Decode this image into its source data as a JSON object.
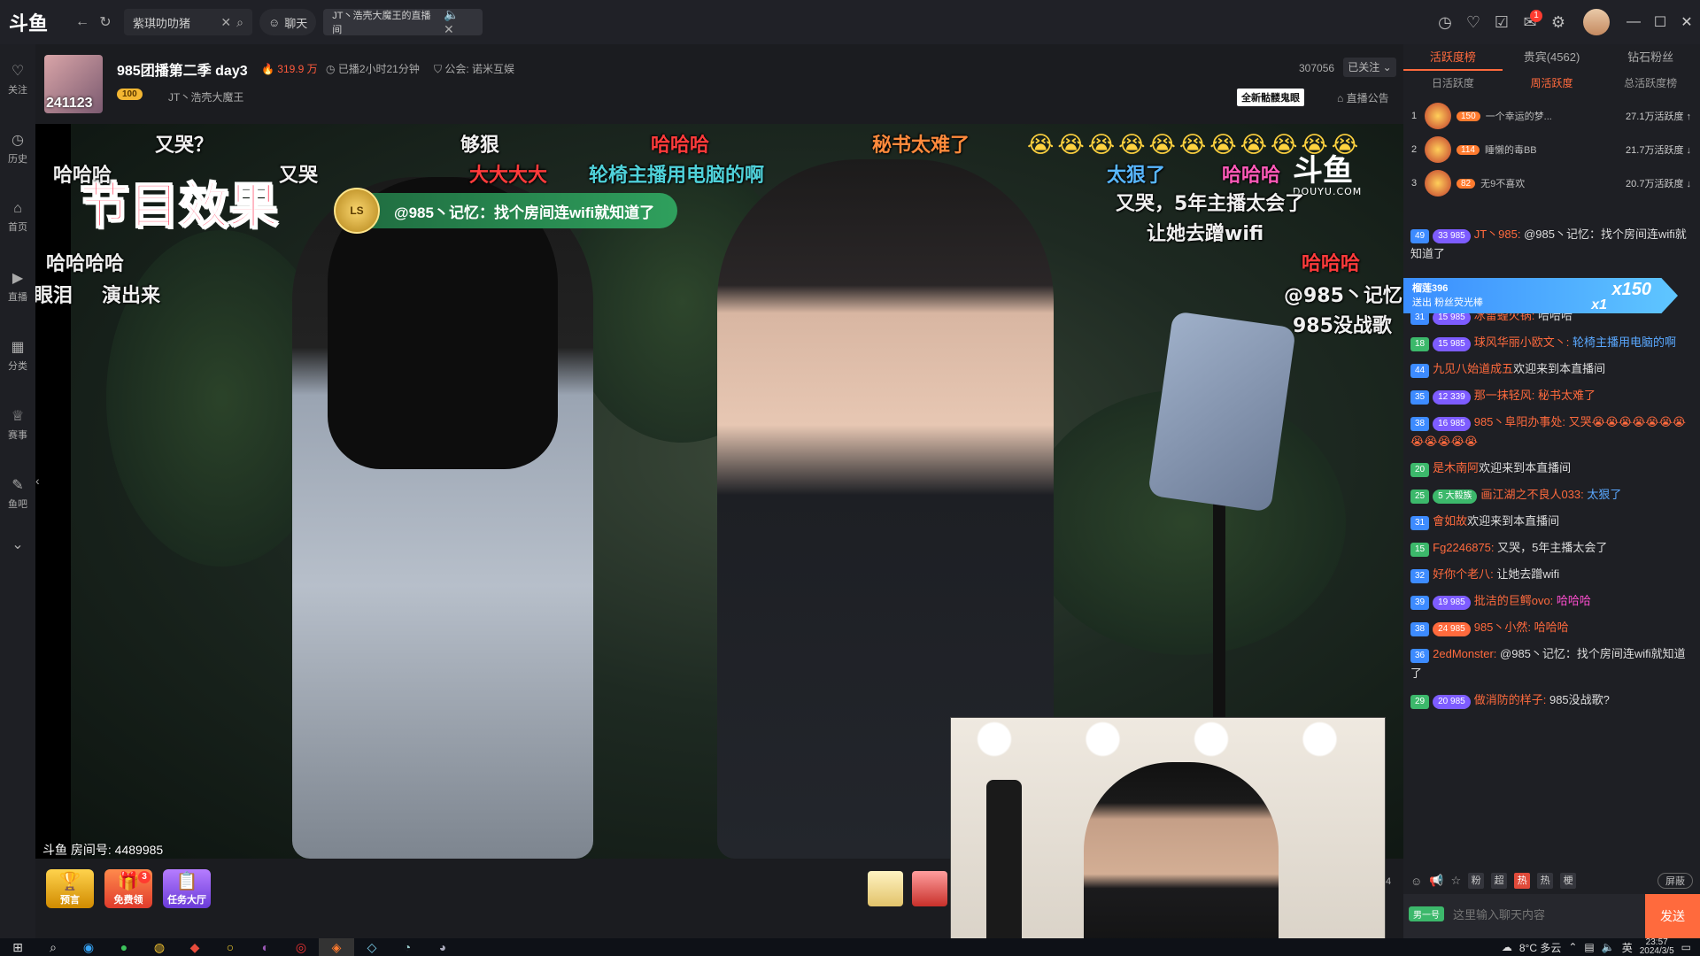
{
  "window": {
    "logo": "斗鱼",
    "tabs": [
      {
        "label": "紫琪叻叻猪"
      },
      {
        "label": "聊天"
      },
      {
        "label": "JT丶浩壳大魔王的直播间"
      }
    ],
    "notification_count": "1"
  },
  "sidebar": {
    "items": [
      {
        "label": "关注",
        "icon": "heart-icon"
      },
      {
        "label": "历史",
        "icon": "clock-icon"
      },
      {
        "label": "首页",
        "icon": "home-icon"
      },
      {
        "label": "直播",
        "icon": "live-icon"
      },
      {
        "label": "分类",
        "icon": "grid-icon"
      },
      {
        "label": "赛事",
        "icon": "trophy-icon"
      },
      {
        "label": "鱼吧",
        "icon": "forum-icon"
      }
    ]
  },
  "stream": {
    "avatar_text": "241123",
    "title": "985团播第二季 day3",
    "heat": "319.9 万",
    "duration": "已播2小时21分钟",
    "guild": "公会: 诺米互娱",
    "level_badge": "100",
    "anchor_name": "JT丶浩壳大魔王",
    "followers": "307056",
    "follow_button": "已关注",
    "new_skin": "全新骷髅鬼眼",
    "notice": "直播公告",
    "room_id": "斗鱼 房间号: 4489985"
  },
  "danmaku": {
    "big_effect": "节目效果",
    "highlight_user_level": "LS",
    "highlight_text": "@985丶记忆：找个房间连wifi就知道了",
    "watermark": "斗鱼",
    "watermark_sub": "DOUYU.COM",
    "items": [
      {
        "text": "又哭？",
        "color": "w"
      },
      {
        "text": "够狠",
        "color": "w"
      },
      {
        "text": "哈哈哈",
        "color": "r"
      },
      {
        "text": "秘书太难了",
        "color": "o"
      },
      {
        "text": "哈哈哈",
        "color": "w"
      },
      {
        "text": "又哭",
        "color": "w"
      },
      {
        "text": "大大大大",
        "color": "r"
      },
      {
        "text": "轮椅主播用电脑的啊",
        "color": "c"
      },
      {
        "text": "太狠了",
        "color": "b"
      },
      {
        "text": "哈哈哈",
        "color": "p"
      },
      {
        "text": "又哭，5年主播太会了",
        "color": "w"
      },
      {
        "text": "让她去蹭wifi",
        "color": "w"
      },
      {
        "text": "哈哈哈哈",
        "color": "w"
      },
      {
        "text": "哈哈哈",
        "color": "r"
      },
      {
        "text": "眼泪",
        "color": "w"
      },
      {
        "text": "演出来",
        "color": "w"
      },
      {
        "text": "@985丶记忆",
        "color": "w"
      },
      {
        "text": "985没战歌",
        "color": "w"
      }
    ],
    "emoji": "😭😭😭😭😭😭😭😭😭😭😭"
  },
  "bottom": {
    "buttons": [
      {
        "label": "预言"
      },
      {
        "label": "免费领"
      },
      {
        "label": "任务大厅"
      }
    ],
    "free_badge": "3",
    "side_number": "4"
  },
  "rank": {
    "tabs": [
      {
        "label": "活跃度榜"
      },
      {
        "label": "贵宾(4562)"
      },
      {
        "label": "钻石粉丝"
      }
    ],
    "subtabs": [
      {
        "label": "日活跃度"
      },
      {
        "label": "周活跃度"
      },
      {
        "label": "总活跃度榜"
      }
    ],
    "rows": [
      {
        "rank": "1",
        "level": "150",
        "name": "一个幸运的梦...",
        "score": "27.1万活跃度 ↑"
      },
      {
        "rank": "2",
        "level": "114",
        "name": "睡懒的毒BB",
        "score": "21.7万活跃度 ↓"
      },
      {
        "rank": "3",
        "level": "82",
        "name": "无9不喜欢",
        "score": "20.7万活跃度 ↓"
      }
    ]
  },
  "gift_banner": {
    "line1": "榴莲396",
    "line2": "送出  粉丝荧光棒",
    "count": "x150",
    "count2": "x1"
  },
  "chat": {
    "messages": [
      {
        "lv": "49",
        "fan": "33 985",
        "user": "JT丶985:",
        "text": "@985丶记忆：找个房间连wifi就知道了"
      },
      {
        "lv": "31",
        "fan": "15 985",
        "user": "冰雷蝗火锅:",
        "text": "哈哈哈"
      },
      {
        "lv": "18",
        "fan": "15 985",
        "user": "球风华丽小欧文丶:",
        "text": "轮椅主播用电脑的啊"
      },
      {
        "lv": "44",
        "fan": "",
        "user": "九见八始道成五",
        "text": "欢迎来到本直播间"
      },
      {
        "lv": "35",
        "fan": "12 339",
        "user": "那一抹轻风:",
        "text": "秘书太难了"
      },
      {
        "lv": "38",
        "fan": "16 985",
        "user": "985丶阜阳办事处:",
        "text": "又哭😭😭😭😭😭😭😭😭😭😭😭😭"
      },
      {
        "lv": "20",
        "fan": "",
        "user": "是木南阿",
        "text": "欢迎来到本直播间"
      },
      {
        "lv": "25",
        "fan": "5 大毅族",
        "user": "画江湖之不良人033:",
        "text": "太狠了"
      },
      {
        "lv": "31",
        "fan": "",
        "user": "會如故",
        "text": "欢迎来到本直播间"
      },
      {
        "lv": "15",
        "fan": "",
        "user": "Fg2246875:",
        "text": "又哭，5年主播太会了"
      },
      {
        "lv": "32",
        "fan": "",
        "user": "好你个老八:",
        "text": "让她去蹭wifi"
      },
      {
        "lv": "39",
        "fan": "19 985",
        "user": "批洁的巨鳄ovo:",
        "text": "哈哈哈"
      },
      {
        "lv": "38",
        "fan": "24 985",
        "user": "985丶小然:",
        "text": "哈哈哈"
      },
      {
        "lv": "36",
        "fan": "",
        "user": "2edMonster:",
        "text": "@985丶记忆：找个房间连wifi就知道了"
      },
      {
        "lv": "29",
        "fan": "20 985",
        "user": "做消防的样子:",
        "text": "985没战歌?"
      }
    ],
    "tools": [
      "粉",
      "超",
      "热",
      "热",
      "梗"
    ],
    "block_label": "屏蔽",
    "identity": "男一号",
    "input_placeholder": "这里输入聊天内容",
    "send_label": "发送"
  },
  "taskbar": {
    "weather": "8°C 多云",
    "ime": "英",
    "time": "23:57",
    "date": "2024/3/5"
  }
}
